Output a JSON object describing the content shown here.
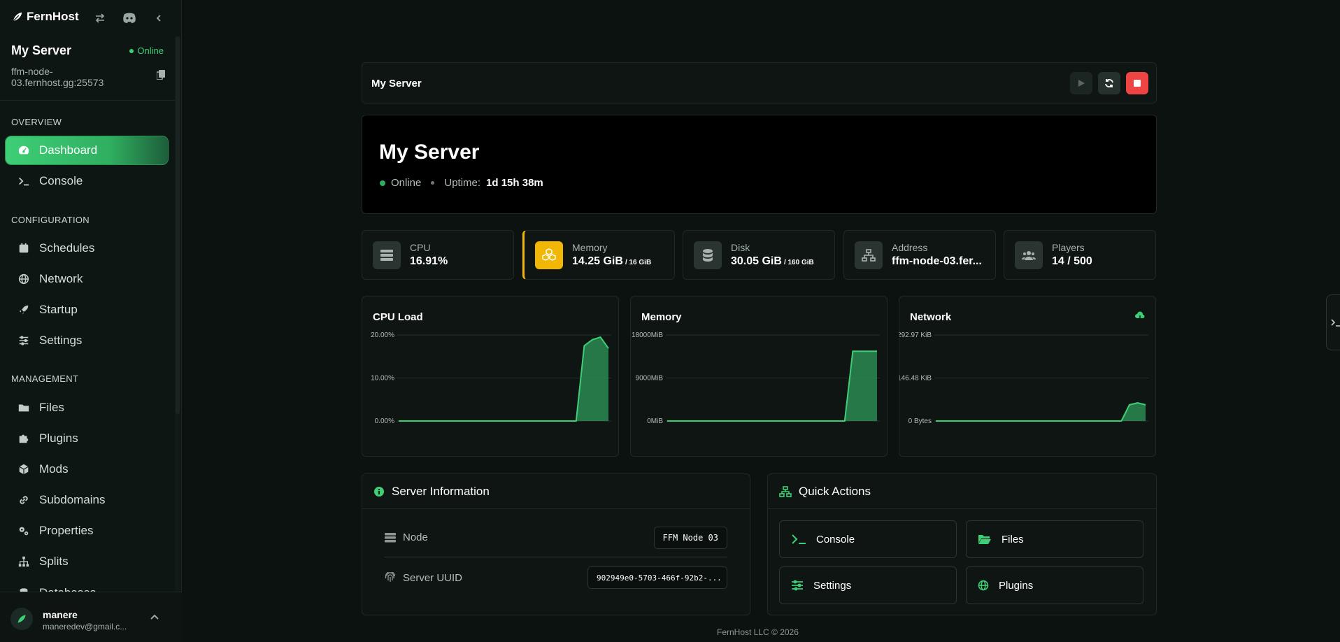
{
  "app": {
    "brand": "FernHost"
  },
  "sidebar": {
    "server_name": "My Server",
    "server_status": "Online",
    "server_address": "ffm-node-03.fernhost.gg:25573",
    "sections": {
      "overview": "OVERVIEW",
      "configuration": "CONFIGURATION",
      "management": "MANAGEMENT"
    },
    "items": [
      {
        "label": "Dashboard",
        "icon": "gauge-icon"
      },
      {
        "label": "Console",
        "icon": "terminal-icon"
      },
      {
        "label": "Schedules",
        "icon": "calendar-icon"
      },
      {
        "label": "Network",
        "icon": "globe-icon"
      },
      {
        "label": "Startup",
        "icon": "rocket-icon"
      },
      {
        "label": "Settings",
        "icon": "sliders-icon"
      },
      {
        "label": "Files",
        "icon": "folder-icon"
      },
      {
        "label": "Plugins",
        "icon": "puzzle-icon"
      },
      {
        "label": "Mods",
        "icon": "cube-icon"
      },
      {
        "label": "Subdomains",
        "icon": "link-icon"
      },
      {
        "label": "Properties",
        "icon": "gears-icon"
      },
      {
        "label": "Splits",
        "icon": "sitemap-icon"
      },
      {
        "label": "Databases",
        "icon": "database-icon"
      }
    ],
    "user": {
      "name": "manere",
      "email": "maneredev@gmail.c..."
    }
  },
  "topbar": {
    "title": "My Server"
  },
  "hero": {
    "title": "My Server",
    "status": "Online",
    "uptime_label": "Uptime:",
    "uptime_value": "1d 15h 38m"
  },
  "stats": [
    {
      "label": "CPU",
      "value": "16.91%",
      "suffix": "",
      "icon": "server-icon"
    },
    {
      "label": "Memory",
      "value": "14.25 GiB",
      "suffix": "/ 16 GiB",
      "icon": "cubes-icon"
    },
    {
      "label": "Disk",
      "value": "30.05 GiB",
      "suffix": "/ 160 GiB",
      "icon": "database-icon"
    },
    {
      "label": "Address",
      "value": "ffm-node-03.fer...",
      "suffix": "",
      "icon": "network-icon"
    },
    {
      "label": "Players",
      "value": "14 / 500",
      "suffix": "",
      "icon": "users-icon"
    }
  ],
  "graphs": {
    "cpu": {
      "title": "CPU Load",
      "ticks": [
        "20.00%",
        "10.00%",
        "0.00%"
      ],
      "ylim": [
        0,
        20
      ],
      "points": [
        0,
        0,
        0,
        0,
        0,
        0,
        0,
        0,
        0,
        0,
        0,
        0,
        0,
        0,
        0,
        0,
        0,
        0,
        0,
        0,
        0,
        0,
        0,
        17.5,
        18.9,
        19.5,
        16.9
      ]
    },
    "memory": {
      "title": "Memory",
      "ticks": [
        "18000MiB",
        "9000MiB",
        "0MiB"
      ],
      "ylim": [
        0,
        18000
      ],
      "points": [
        0,
        0,
        0,
        0,
        0,
        0,
        0,
        0,
        0,
        0,
        0,
        0,
        0,
        0,
        0,
        0,
        0,
        0,
        0,
        0,
        0,
        0,
        0,
        14600,
        14600,
        14600,
        14600
      ]
    },
    "network": {
      "title": "Network",
      "ticks": [
        "292.97 KiB",
        "146.48 KiB",
        "0 Bytes"
      ],
      "ylim": [
        0,
        292.97
      ],
      "points": [
        0,
        0,
        0,
        0,
        0,
        0,
        0,
        0,
        0,
        0,
        0,
        0,
        0,
        0,
        0,
        0,
        0,
        0,
        0,
        0,
        0,
        0,
        0,
        0,
        55,
        62,
        55
      ]
    }
  },
  "server_info": {
    "title": "Server Information",
    "rows": [
      {
        "label": "Node",
        "value": "FFM Node 03"
      },
      {
        "label": "Server UUID",
        "value": "902949e0-5703-466f-92b2-..."
      }
    ]
  },
  "quick_actions": {
    "title": "Quick Actions",
    "buttons": [
      {
        "label": "Console"
      },
      {
        "label": "Files"
      },
      {
        "label": "Settings"
      },
      {
        "label": "Plugins"
      }
    ]
  },
  "footer": {
    "text": "FernHost LLC © 2026"
  },
  "colors": {
    "accent": "#3ecf76",
    "stop": "#ef4444",
    "memory_highlight": "#f2b705"
  }
}
